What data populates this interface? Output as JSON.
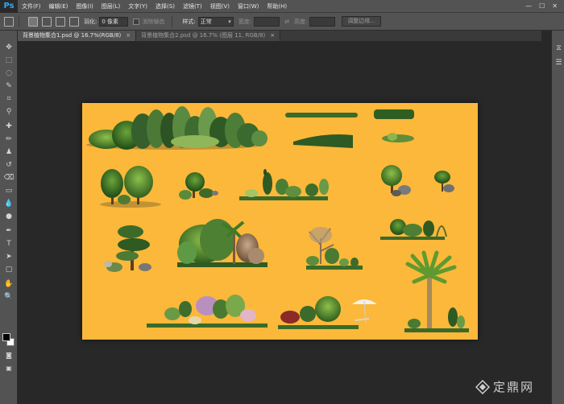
{
  "app": {
    "logo": "Ps"
  },
  "menu": [
    "文件(F)",
    "编辑(E)",
    "图像(I)",
    "图层(L)",
    "文字(Y)",
    "选择(S)",
    "滤镜(T)",
    "视图(V)",
    "窗口(W)",
    "帮助(H)"
  ],
  "window_controls": [
    "—",
    "☐",
    "✕"
  ],
  "options": {
    "feather_label": "羽化:",
    "feather_value": "0 像素",
    "antialias_label": "消除锯齿",
    "style_label": "样式:",
    "style_value": "正常",
    "width_label": "宽度:",
    "height_label": "高度:",
    "refine_button": "调整边缘..."
  },
  "tabs": [
    {
      "label": "背景植物集合1.psd @ 16.7%(RGB/8)",
      "close": "×",
      "active": true
    },
    {
      "label": "背景植物集合2.psd @ 16.7% (图层 11, RGB/8)",
      "close": "×",
      "active": false
    }
  ],
  "tools": [
    "move-icon",
    "marquee-icon",
    "lasso-icon",
    "quick-select-icon",
    "crop-icon",
    "eyedropper-icon",
    "healing-brush-icon",
    "brush-icon",
    "clone-stamp-icon",
    "history-brush-icon",
    "eraser-icon",
    "gradient-icon",
    "blur-icon",
    "dodge-icon",
    "pen-icon",
    "type-icon",
    "path-select-icon",
    "rectangle-icon",
    "hand-icon",
    "zoom-icon"
  ],
  "tool_glyphs": [
    "✥",
    "⬚",
    "◌",
    "✎",
    "⌗",
    "⚲",
    "✚",
    "✏",
    "♟",
    "↺",
    "⌫",
    "▭",
    "💧",
    "●",
    "✒",
    "T",
    "➤",
    "▢",
    "✋",
    "🔍"
  ],
  "canvas": {
    "background": "#fbb83a"
  },
  "watermark": {
    "text": "定鼎网"
  }
}
